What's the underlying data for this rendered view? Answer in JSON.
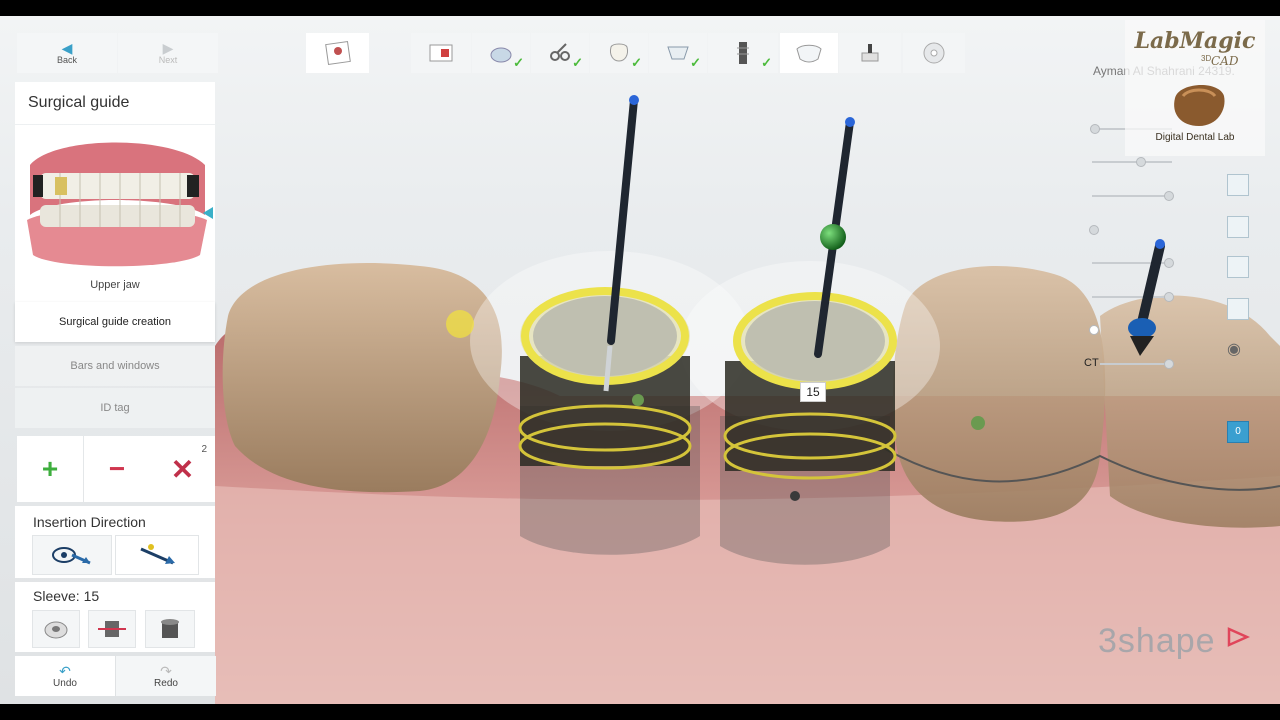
{
  "nav": {
    "back_label": "Back",
    "next_label": "Next"
  },
  "panel": {
    "title": "Surgical guide",
    "jaw_label": "Upper jaw",
    "menu": [
      "Surgical guide creation",
      "Bars and windows",
      "ID tag"
    ],
    "remove_count": "2",
    "insertion_label": "Insertion Direction",
    "sleeve_label": "Sleeve: 15"
  },
  "history": {
    "undo_label": "Undo",
    "redo_label": "Redo"
  },
  "scene": {
    "sleeve_number": "15"
  },
  "right": {
    "user_name": "Ayman Al Shahrani 24319.",
    "ct_label": "CT",
    "badge": "0"
  },
  "watermark": {
    "brand": "3shape",
    "logo_line1": "LabMagic",
    "logo_line2": "CAD",
    "logo_sup": "3D",
    "logo_caption": "Digital Dental Lab"
  },
  "colors": {
    "accent": "#3aa0c8",
    "ok": "#4cbb3c",
    "remove": "#d0364f",
    "delete": "#c0304a",
    "add": "#3dae3d"
  }
}
